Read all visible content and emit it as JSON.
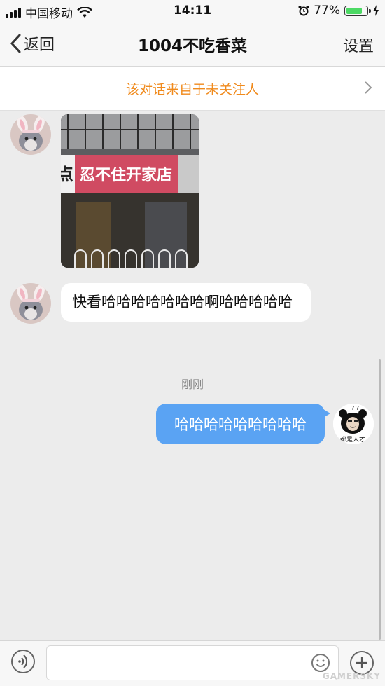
{
  "status_bar": {
    "carrier": "中国移动",
    "time": "14:11",
    "battery": "77%",
    "battery_level": 0.77
  },
  "nav": {
    "back_label": "返回",
    "title": "1004不吃香菜",
    "settings_label": "设置"
  },
  "notice": {
    "text": "该对话来自于未关注人"
  },
  "messages": {
    "image_sign_text": "忍不住开家店",
    "image_sign_left": "点",
    "incoming_text": "快看哈哈哈哈哈哈哈啊哈哈哈哈哈",
    "timestamp": "刚刚",
    "outgoing_text": "哈哈哈哈哈哈哈哈哈",
    "my_avatar_caption": "都是人才"
  },
  "input": {
    "value": "",
    "placeholder": ""
  },
  "watermark": "GAMERSKY",
  "colors": {
    "accent_blue": "#5aa3f3",
    "notice_orange": "#f08a1c",
    "battery_green": "#4cd964"
  }
}
